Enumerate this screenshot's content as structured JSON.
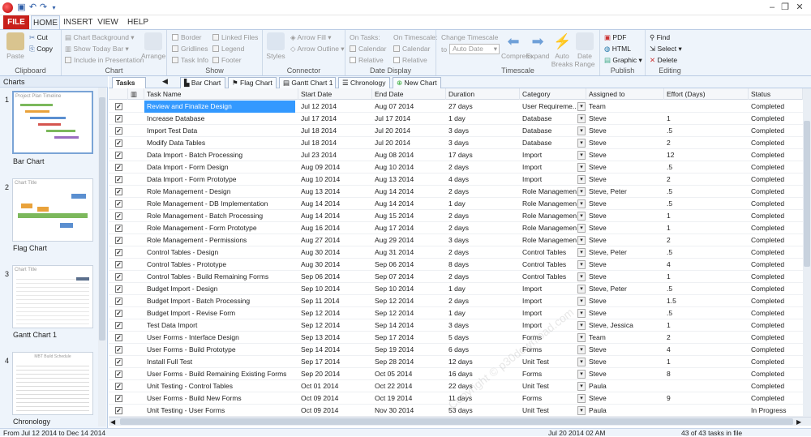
{
  "window": {
    "close": "✕",
    "minimize": "–",
    "restore": "❐"
  },
  "ribbon_tabs": {
    "file": "FILE",
    "home": "HOME",
    "insert": "INSERT",
    "view": "VIEW",
    "help": "HELP"
  },
  "clipboard": {
    "paste": "Paste",
    "cut": "Cut",
    "copy": "Copy",
    "title": "Clipboard"
  },
  "chart_group": {
    "background": "Chart Background",
    "today_bar": "Show Today Bar",
    "include_presentation": "Include in Presentation",
    "arrange": "Arrange",
    "title": "Chart"
  },
  "show_group": {
    "border": "Border",
    "gridlines": "Gridlines",
    "task_info": "Task Info",
    "linked_files": "Linked Files",
    "legend": "Legend",
    "footer": "Footer",
    "title": "Show"
  },
  "connector_group": {
    "styles": "Styles",
    "arrow_fill": "Arrow Fill",
    "arrow_outline": "Arrow Outline",
    "title": "Connector"
  },
  "date_display": {
    "on_tasks": "On Tasks:",
    "on_timescale": "On Timescale:",
    "calendar1": "Calendar",
    "relative1": "Relative",
    "calendar2": "Calendar",
    "relative2": "Relative",
    "title": "Date Display"
  },
  "timescale_group": {
    "change": "Change Timescale",
    "to": "to",
    "value": "Auto Date",
    "compress": "Compress",
    "expand": "Expand",
    "auto_breaks": "Auto Breaks",
    "date_range": "Date Range",
    "title": "Timescale"
  },
  "publish_group": {
    "pdf": "PDF",
    "html": "HTML",
    "graphic": "Graphic",
    "title": "Publish"
  },
  "editing_group": {
    "find": "Find",
    "select": "Select",
    "delete": "Delete",
    "title": "Editing"
  },
  "charts_panel": {
    "title": "Charts",
    "items": [
      {
        "num": "1",
        "label": "Bar Chart",
        "thumb_title": "Project Plan Timeline"
      },
      {
        "num": "2",
        "label": "Flag Chart",
        "thumb_title": "Chart Title"
      },
      {
        "num": "3",
        "label": "Gantt Chart 1",
        "thumb_title": "Chart Title"
      },
      {
        "num": "4",
        "label": "Chronology",
        "thumb_title": "MBT Build Schedule"
      }
    ]
  },
  "doc_tabs": {
    "tasks": "Tasks",
    "bar": "Bar Chart",
    "flag": "Flag Chart",
    "gantt": "Gantt Chart 1",
    "chronology": "Chronology",
    "new": "New Chart"
  },
  "columns": {
    "task": "Task Name",
    "start": "Start Date",
    "end": "End Date",
    "duration": "Duration",
    "category": "Category",
    "assigned": "Assigned to",
    "effort": "Effort (Days)",
    "status": "Status"
  },
  "rows": [
    {
      "name": "Review and Finalize Design",
      "start": "Jul 12 2014",
      "end": "Aug 07 2014",
      "dur": "27 days",
      "cat": "User Requireme...",
      "who": "Team",
      "eff": "",
      "st": "Completed"
    },
    {
      "name": "Increase Database",
      "start": "Jul 17 2014",
      "end": "Jul 17 2014",
      "dur": "1 day",
      "cat": "Database",
      "who": "Steve",
      "eff": "1",
      "st": "Completed"
    },
    {
      "name": "Import Test Data",
      "start": "Jul 18 2014",
      "end": "Jul 20 2014",
      "dur": "3 days",
      "cat": "Database",
      "who": "Steve",
      "eff": ".5",
      "st": "Completed"
    },
    {
      "name": "Modify Data Tables",
      "start": "Jul 18 2014",
      "end": "Jul 20 2014",
      "dur": "3 days",
      "cat": "Database",
      "who": "Steve",
      "eff": "2",
      "st": "Completed"
    },
    {
      "name": "Data Import - Batch Processing",
      "start": "Jul 23 2014",
      "end": "Aug 08 2014",
      "dur": "17 days",
      "cat": "Import",
      "who": "Steve",
      "eff": "12",
      "st": "Completed"
    },
    {
      "name": "Data Import - Form Design",
      "start": "Aug 09 2014",
      "end": "Aug 10 2014",
      "dur": "2 days",
      "cat": "Import",
      "who": "Steve",
      "eff": ".5",
      "st": "Completed"
    },
    {
      "name": "Data Import - Form Prototype",
      "start": "Aug 10 2014",
      "end": "Aug 13 2014",
      "dur": "4 days",
      "cat": "Import",
      "who": "Steve",
      "eff": "2",
      "st": "Completed"
    },
    {
      "name": "Role Management - Design",
      "start": "Aug 13 2014",
      "end": "Aug 14 2014",
      "dur": "2 days",
      "cat": "Role Management",
      "who": "Steve, Peter",
      "eff": ".5",
      "st": "Completed"
    },
    {
      "name": "Role Management - DB Implementation",
      "start": "Aug 14 2014",
      "end": "Aug 14 2014",
      "dur": "1 day",
      "cat": "Role Management",
      "who": "Steve",
      "eff": ".5",
      "st": "Completed"
    },
    {
      "name": "Role Management - Batch Processing",
      "start": "Aug 14 2014",
      "end": "Aug 15 2014",
      "dur": "2 days",
      "cat": "Role Management",
      "who": "Steve",
      "eff": "1",
      "st": "Completed"
    },
    {
      "name": "Role Management - Form Prototype",
      "start": "Aug 16 2014",
      "end": "Aug 17 2014",
      "dur": "2 days",
      "cat": "Role Management",
      "who": "Steve",
      "eff": "1",
      "st": "Completed"
    },
    {
      "name": "Role Management - Permissions",
      "start": "Aug 27 2014",
      "end": "Aug 29 2014",
      "dur": "3 days",
      "cat": "Role Management",
      "who": "Steve",
      "eff": "2",
      "st": "Completed"
    },
    {
      "name": "Control Tables - Design",
      "start": "Aug 30 2014",
      "end": "Aug 31 2014",
      "dur": "2 days",
      "cat": "Control Tables",
      "who": "Steve, Peter",
      "eff": ".5",
      "st": "Completed"
    },
    {
      "name": "Control Tables - Prototype",
      "start": "Aug 30 2014",
      "end": "Sep 06 2014",
      "dur": "8 days",
      "cat": "Control Tables",
      "who": "Steve",
      "eff": "4",
      "st": "Completed"
    },
    {
      "name": "Control Tables - Build Remaining Forms",
      "start": "Sep 06 2014",
      "end": "Sep 07 2014",
      "dur": "2 days",
      "cat": "Control Tables",
      "who": "Steve",
      "eff": "1",
      "st": "Completed"
    },
    {
      "name": "Budget Import - Design",
      "start": "Sep 10 2014",
      "end": "Sep 10 2014",
      "dur": "1 day",
      "cat": "Import",
      "who": "Steve, Peter",
      "eff": ".5",
      "st": "Completed"
    },
    {
      "name": "Budget Import - Batch Processing",
      "start": "Sep 11 2014",
      "end": "Sep 12 2014",
      "dur": "2 days",
      "cat": "Import",
      "who": "Steve",
      "eff": "1.5",
      "st": "Completed"
    },
    {
      "name": "Budget Import - Revise Form",
      "start": "Sep 12 2014",
      "end": "Sep 12 2014",
      "dur": "1 day",
      "cat": "Import",
      "who": "Steve",
      "eff": ".5",
      "st": "Completed"
    },
    {
      "name": "Test Data Import",
      "start": "Sep 12 2014",
      "end": "Sep 14 2014",
      "dur": "3 days",
      "cat": "Import",
      "who": "Steve, Jessica",
      "eff": "1",
      "st": "Completed"
    },
    {
      "name": "User Forms - Interface Design",
      "start": "Sep 13 2014",
      "end": "Sep 17 2014",
      "dur": "5 days",
      "cat": "Forms",
      "who": "Team",
      "eff": "2",
      "st": "Completed"
    },
    {
      "name": "User Forms - Build Prototype",
      "start": "Sep 14 2014",
      "end": "Sep 19 2014",
      "dur": "6 days",
      "cat": "Forms",
      "who": "Steve",
      "eff": "4",
      "st": "Completed"
    },
    {
      "name": "Install Full Test",
      "start": "Sep 17 2014",
      "end": "Sep 28 2014",
      "dur": "12 days",
      "cat": "Unit Test",
      "who": "Steve",
      "eff": "1",
      "st": "Completed"
    },
    {
      "name": "User Forms - Build Remaining Existing Forms",
      "start": "Sep 20 2014",
      "end": "Oct 05 2014",
      "dur": "16 days",
      "cat": "Forms",
      "who": "Steve",
      "eff": "8",
      "st": "Completed"
    },
    {
      "name": "Unit Testing - Control Tables",
      "start": "Oct 01 2014",
      "end": "Oct 22 2014",
      "dur": "22 days",
      "cat": "Unit Test",
      "who": "Paula",
      "eff": "",
      "st": "Completed"
    },
    {
      "name": "User Forms - Build New Forms",
      "start": "Oct 09 2014",
      "end": "Oct 19 2014",
      "dur": "11 days",
      "cat": "Forms",
      "who": "Steve",
      "eff": "9",
      "st": "Completed"
    },
    {
      "name": "Unit Testing - User Forms",
      "start": "Oct 09 2014",
      "end": "Nov 30 2014",
      "dur": "53 days",
      "cat": "Unit Test",
      "who": "Paula",
      "eff": "",
      "st": "In Progress"
    }
  ],
  "statusbar": {
    "range": "From Jul 12 2014  to Dec 14 2014",
    "timestamp": "Jul 20 2014 02 AM",
    "count": "43 of 43 tasks in file"
  },
  "watermark": "Copyright © p30download.com"
}
